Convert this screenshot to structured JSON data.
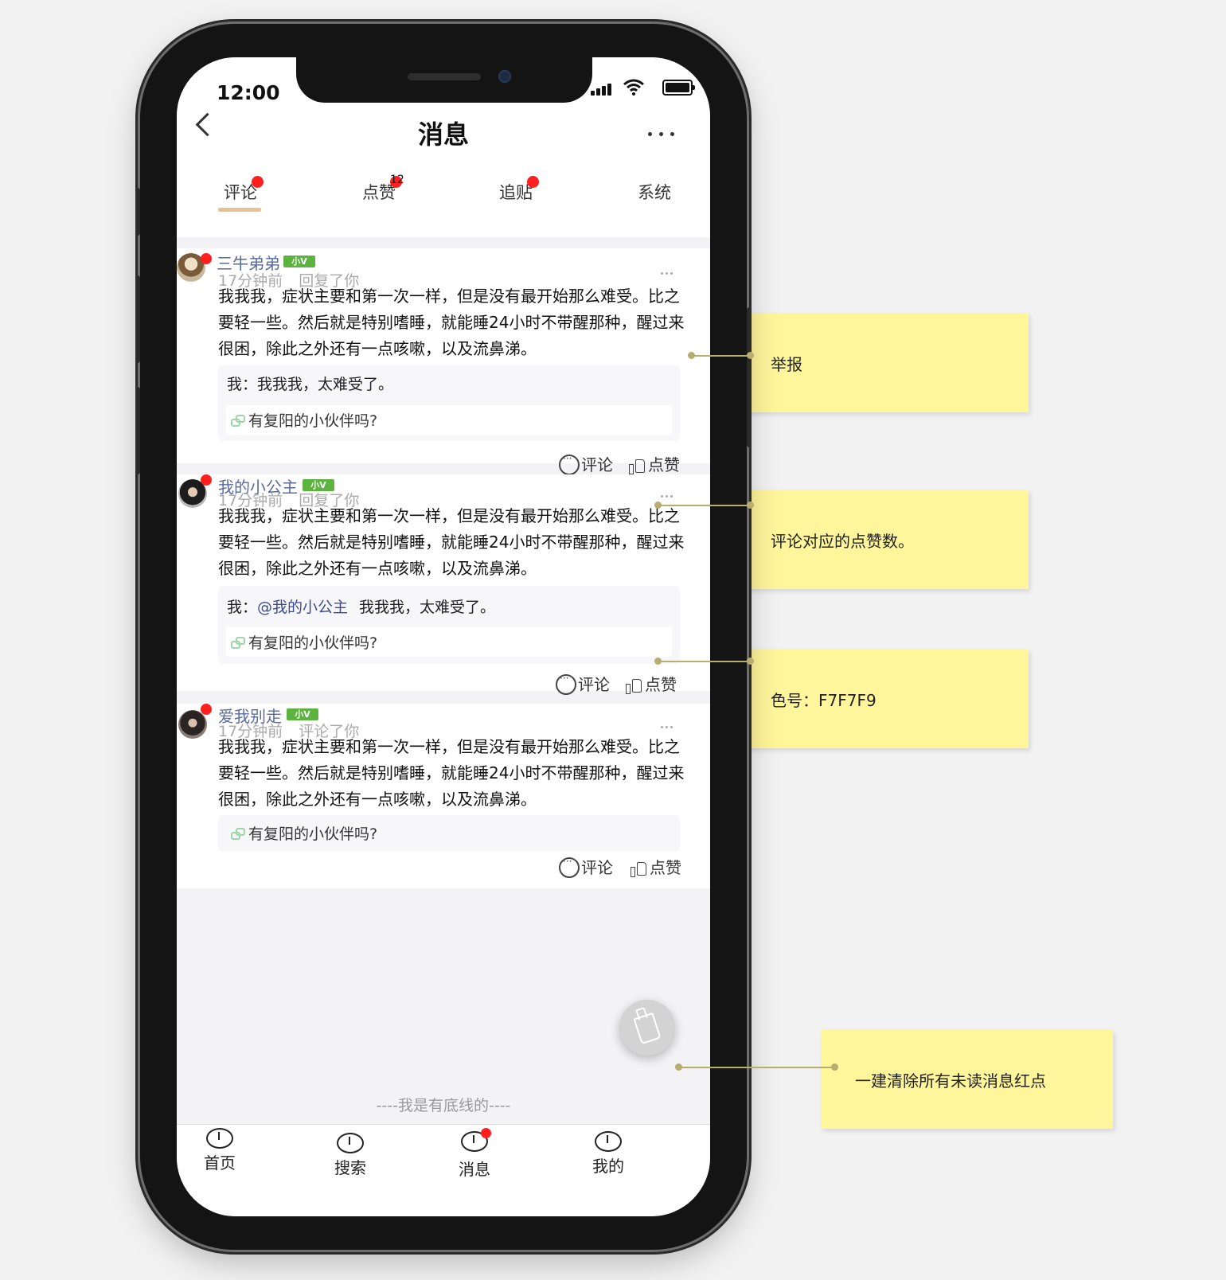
{
  "status_bar": {
    "time": "12:00"
  },
  "header": {
    "title": "消息"
  },
  "tabs": [
    {
      "label": "评论",
      "active": true,
      "red_dot": true
    },
    {
      "label": "点赞",
      "badge": "12"
    },
    {
      "label": "追贴",
      "red_dot": true
    },
    {
      "label": "系统"
    }
  ],
  "messages": [
    {
      "username": "三牛弟弟",
      "level": "小V",
      "time": "17分钟前",
      "action": "回复了你",
      "content": [
        "我我我，症状主要和第一次一样，但是没有最开始那么难受。比之",
        "要轻一些。然后就是特别嗜睡，就能睡24小时不带醒那种，醒过来",
        "很困，除此之外还有一点咳嗽，以及流鼻涕。"
      ],
      "reply_prefix": "我：",
      "reply_mention": "",
      "reply_text": "我我我，太难受了。",
      "thread_title": "有复阳的小伙伴吗?",
      "comment_label": "评论",
      "like_label": "点赞"
    },
    {
      "username": "我的小公主",
      "level": "小V",
      "time": "17分钟前",
      "action": "回复了你",
      "content": [
        "我我我，症状主要和第一次一样，但是没有最开始那么难受。比之",
        "要轻一些。然后就是特别嗜睡，就能睡24小时不带醒那种，醒过来",
        "很困，除此之外还有一点咳嗽，以及流鼻涕。"
      ],
      "reply_prefix": "我：",
      "reply_mention": "@我的小公主",
      "reply_text": "我我我，太难受了。",
      "thread_title": "有复阳的小伙伴吗?",
      "comment_label": "评论",
      "like_label": "点赞"
    },
    {
      "username": "爱我别走",
      "level": "小V",
      "time": "17分钟前",
      "action": "评论了你",
      "content": [
        "我我我，症状主要和第一次一样，但是没有最开始那么难受。比之",
        "要轻一些。然后就是特别嗜睡，就能睡24小时不带醒那种，醒过来",
        "很困，除此之外还有一点咳嗽，以及流鼻涕。"
      ],
      "thread_title": "有复阳的小伙伴吗?",
      "comment_label": "评论",
      "like_label": "点赞"
    }
  ],
  "end_text": "----我是有底线的----",
  "fab": {
    "icon": "brush-icon"
  },
  "bottom_nav": [
    {
      "label": "首页"
    },
    {
      "label": "搜索"
    },
    {
      "label": "消息",
      "red_dot": true
    },
    {
      "label": "我的"
    }
  ],
  "annotations": [
    {
      "text": "举报"
    },
    {
      "text": "评论对应的点赞数。"
    },
    {
      "text": "色号：F7F7F9"
    },
    {
      "text": "一建清除所有未读消息红点"
    }
  ],
  "colors": {
    "red_dot": "#FF1F1F",
    "tab_underline": "#E8C28C",
    "quote_bg": "#F7F7F9",
    "note_bg": "#FFF59B",
    "level_badge": "#5CB340",
    "username": "#5A6B9E"
  }
}
